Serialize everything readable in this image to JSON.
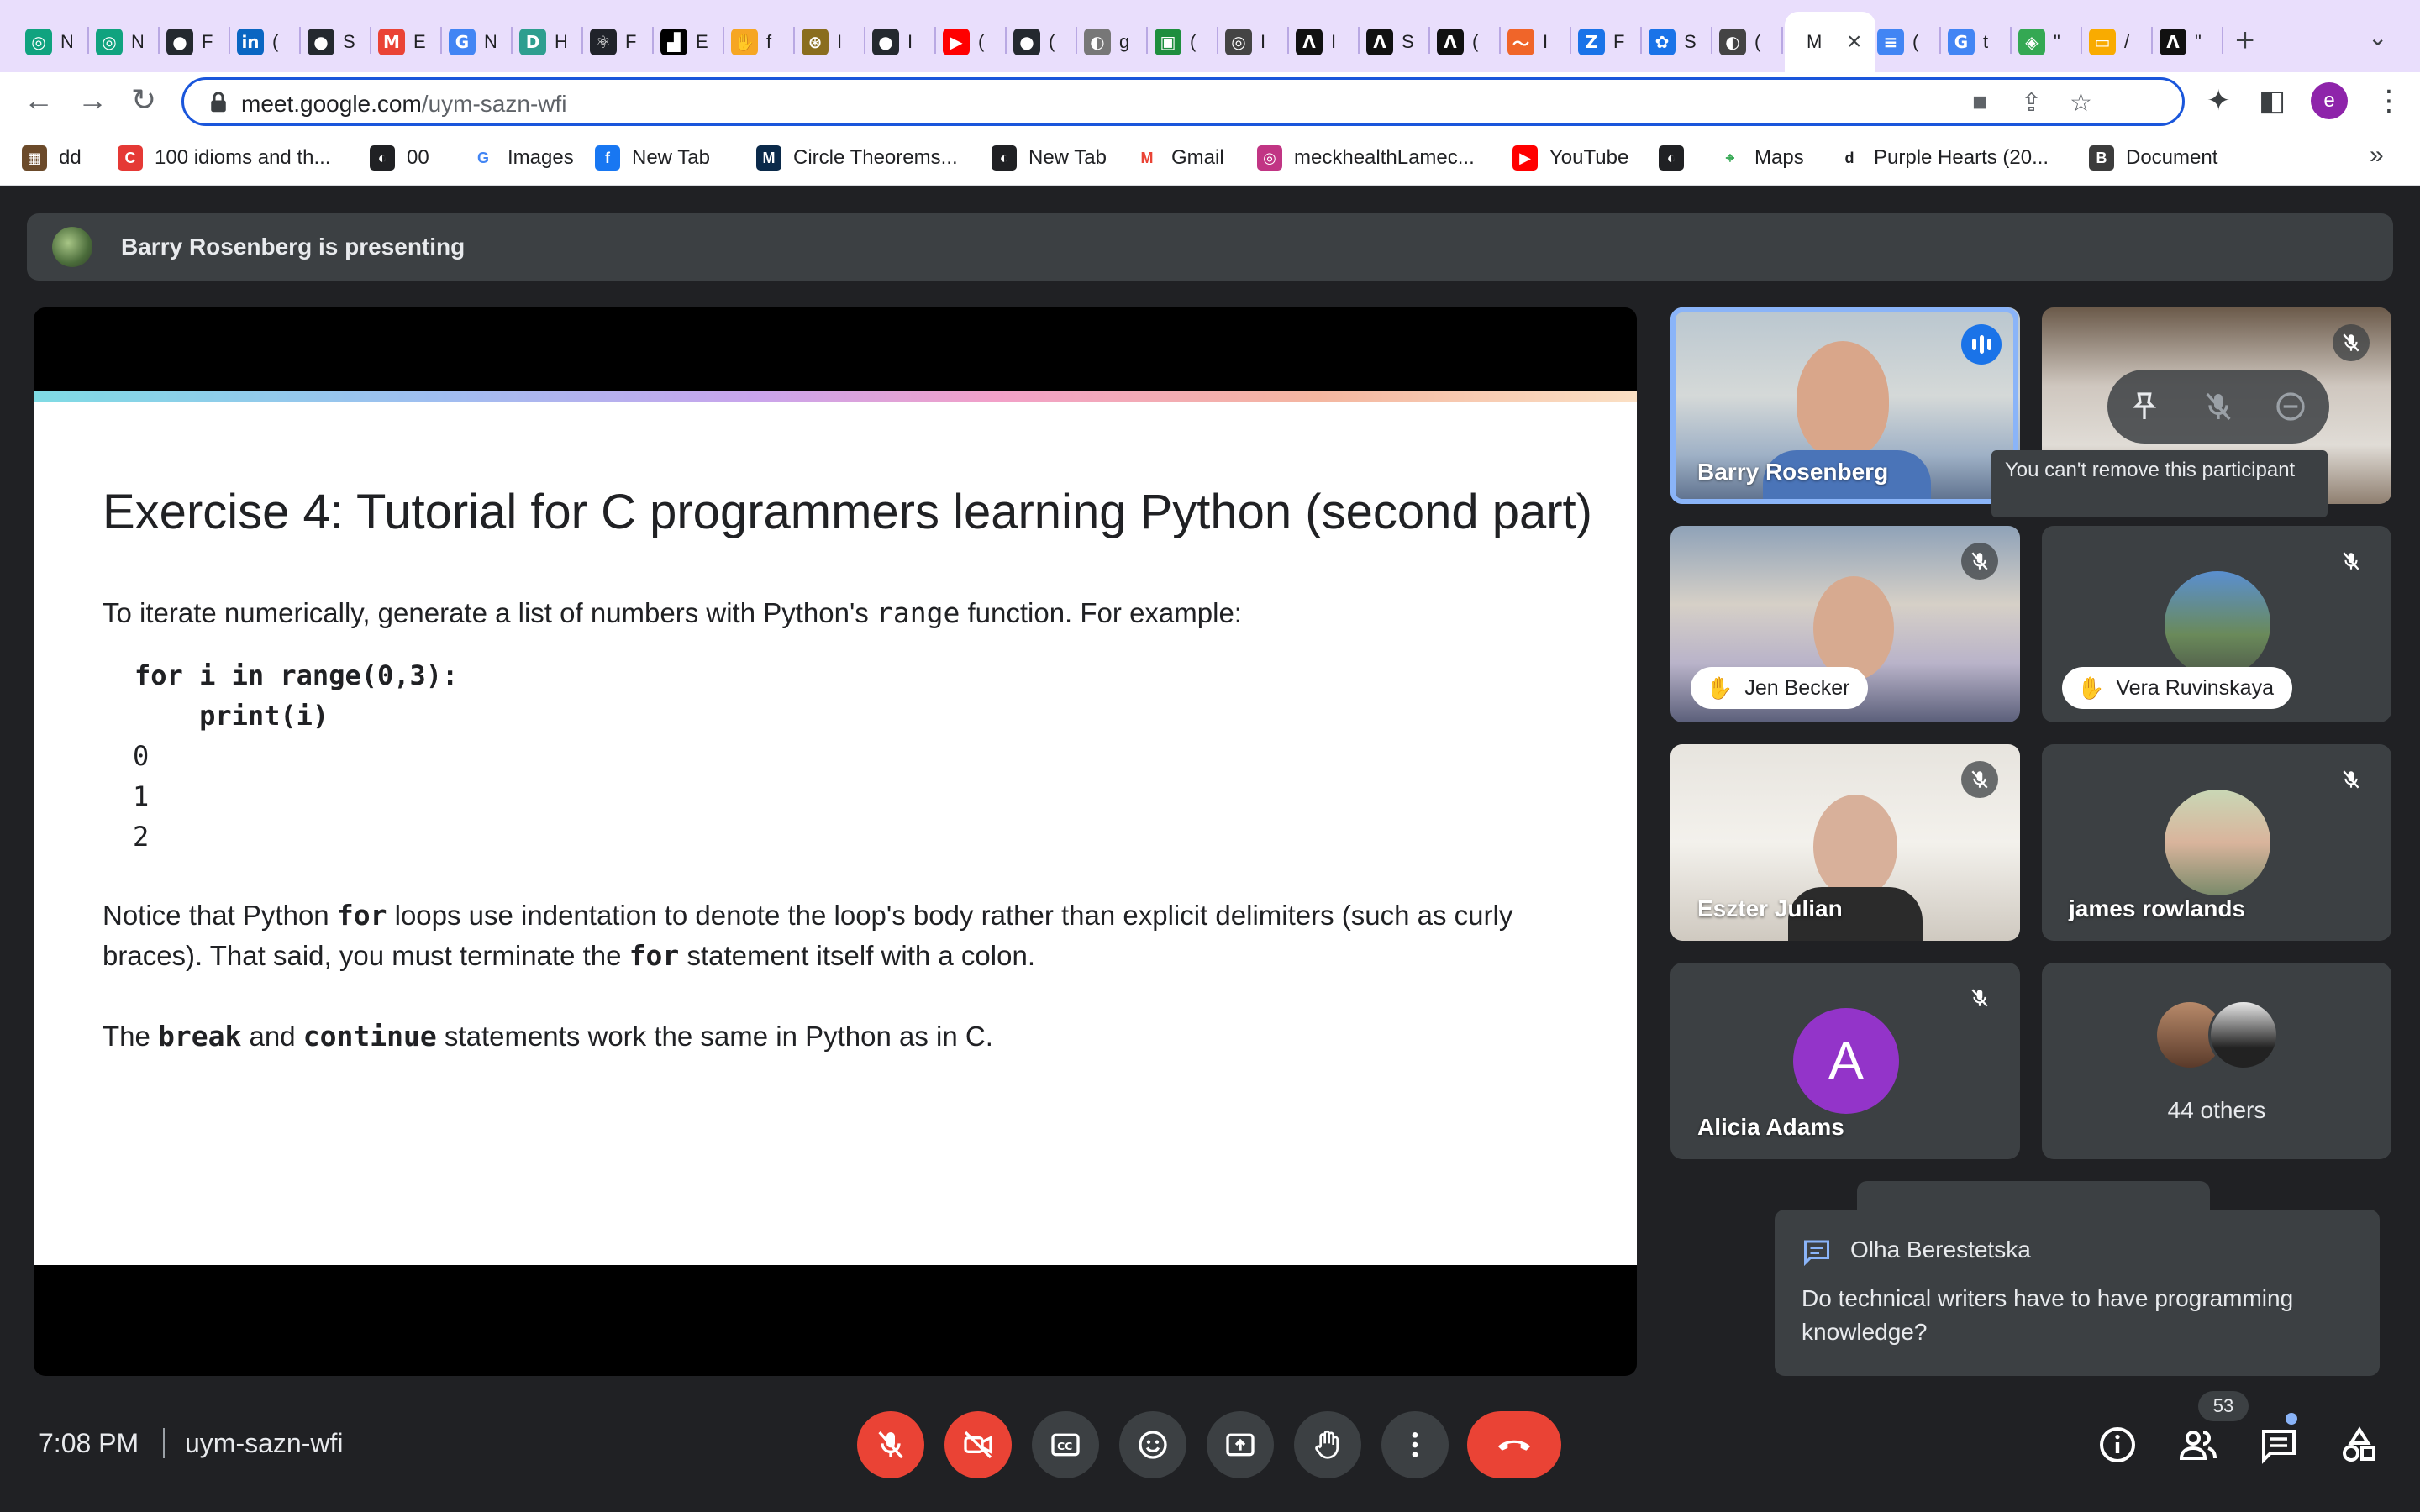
{
  "browser": {
    "active_tab_title": "M",
    "url_host": "meet.google.com",
    "url_path": "/uym-sazn-wfi",
    "profile_initial": "e",
    "bookmarks": [
      {
        "label": "dd"
      },
      {
        "label": "100 idioms and th..."
      },
      {
        "label": "00"
      },
      {
        "label": "Images"
      },
      {
        "label": "New Tab"
      },
      {
        "label": "Circle Theorems..."
      },
      {
        "label": "New Tab"
      },
      {
        "label": "Gmail"
      },
      {
        "label": "meckhealthLamec..."
      },
      {
        "label": "YouTube"
      },
      {
        "label": ""
      },
      {
        "label": "Maps"
      },
      {
        "label": "Purple Hearts (20..."
      },
      {
        "label": "Document"
      }
    ],
    "tabs": [
      {
        "t": "N",
        "c": "#10a37f",
        "g": "◎"
      },
      {
        "t": "N",
        "c": "#10a37f",
        "g": "◎"
      },
      {
        "t": "F",
        "c": "#24292f",
        "g": "●"
      },
      {
        "t": "(",
        "c": "#0a66c2",
        "g": "in"
      },
      {
        "t": "S",
        "c": "#24292f",
        "g": "●"
      },
      {
        "t": "E",
        "c": "#ea4335",
        "g": "M"
      },
      {
        "t": "N",
        "c": "#4285f4",
        "g": "G"
      },
      {
        "t": "H",
        "c": "#2e9e8f",
        "g": "D"
      },
      {
        "t": "F",
        "c": "#20232a",
        "g": "⚛"
      },
      {
        "t": "E",
        "c": "#000000",
        "g": "▟"
      },
      {
        "t": "f",
        "c": "#f6a623",
        "g": "✋"
      },
      {
        "t": "I",
        "c": "#8a6d1e",
        "g": "⊛"
      },
      {
        "t": "I",
        "c": "#24292f",
        "g": "●"
      },
      {
        "t": "(",
        "c": "#ff0000",
        "g": "▶"
      },
      {
        "t": "(",
        "c": "#24292f",
        "g": "●"
      },
      {
        "t": "g",
        "c": "#777777",
        "g": "◐"
      },
      {
        "t": "(",
        "c": "#1e8e3e",
        "g": "▣"
      },
      {
        "t": "I",
        "c": "#444444",
        "g": "◎"
      },
      {
        "t": "I",
        "c": "#111111",
        "g": "Λ"
      },
      {
        "t": "S",
        "c": "#111111",
        "g": "Λ"
      },
      {
        "t": "(",
        "c": "#111111",
        "g": "Λ"
      },
      {
        "t": "I",
        "c": "#f06529",
        "g": "〜"
      },
      {
        "t": "F",
        "c": "#1a73e8",
        "g": "Z"
      },
      {
        "t": "S",
        "c": "#1a73e8",
        "g": "✿"
      },
      {
        "t": "(",
        "c": "#444444",
        "g": "◐"
      }
    ],
    "tabs_after": [
      {
        "t": "(",
        "c": "#4285f4",
        "g": "≡"
      },
      {
        "t": "t",
        "c": "#4285f4",
        "g": "G"
      },
      {
        "t": "\"",
        "c": "#34a853",
        "g": "◈"
      },
      {
        "t": "/",
        "c": "#f9ab00",
        "g": "▭"
      },
      {
        "t": "\"",
        "c": "#111111",
        "g": "Λ"
      }
    ]
  },
  "meet": {
    "presenting_banner": "Barry Rosenberg is presenting",
    "slide": {
      "title": "Exercise 4: Tutorial for C programmers learning Python (second part)",
      "p1_pre": "To iterate numerically, generate a list of numbers with Python's ",
      "p1_code": "range",
      "p1_post": " function.  For example:",
      "code_lines": [
        "for i in range(0,3):",
        "    print(i)",
        "0",
        "1",
        "2"
      ],
      "p2_a": "Notice that Python ",
      "p2_code1": "for",
      "p2_b": " loops use indentation to denote the loop's body rather than explicit delimiters (such as curly braces). That said, you must terminate the ",
      "p2_code2": "for",
      "p2_c": " statement itself with a colon.",
      "p3_a": "The ",
      "p3_code1": "break",
      "p3_b": " and ",
      "p3_code2": "continue",
      "p3_c": " statements work the same in Python as in C."
    },
    "participants": {
      "barry": "Barry Rosenberg",
      "jen": "Jen Becker",
      "vera": "Vera Ruvinskaya",
      "eszter": "Eszter Julian",
      "james": "james rowlands",
      "alicia": "Alicia Adams",
      "alicia_initial": "A",
      "others": "44 others"
    },
    "tooltip": "You can't remove this participant",
    "chat": {
      "sender": "Olha Berestetska",
      "message": "Do technical writers have to have programming knowledge?"
    },
    "clock": "7:08 PM",
    "meeting_code": "uym-sazn-wfi",
    "participant_count": "53",
    "colors": {
      "end_call": "#ea4335",
      "speaking": "#8ab4f8",
      "accent": "#1a73e8"
    }
  }
}
